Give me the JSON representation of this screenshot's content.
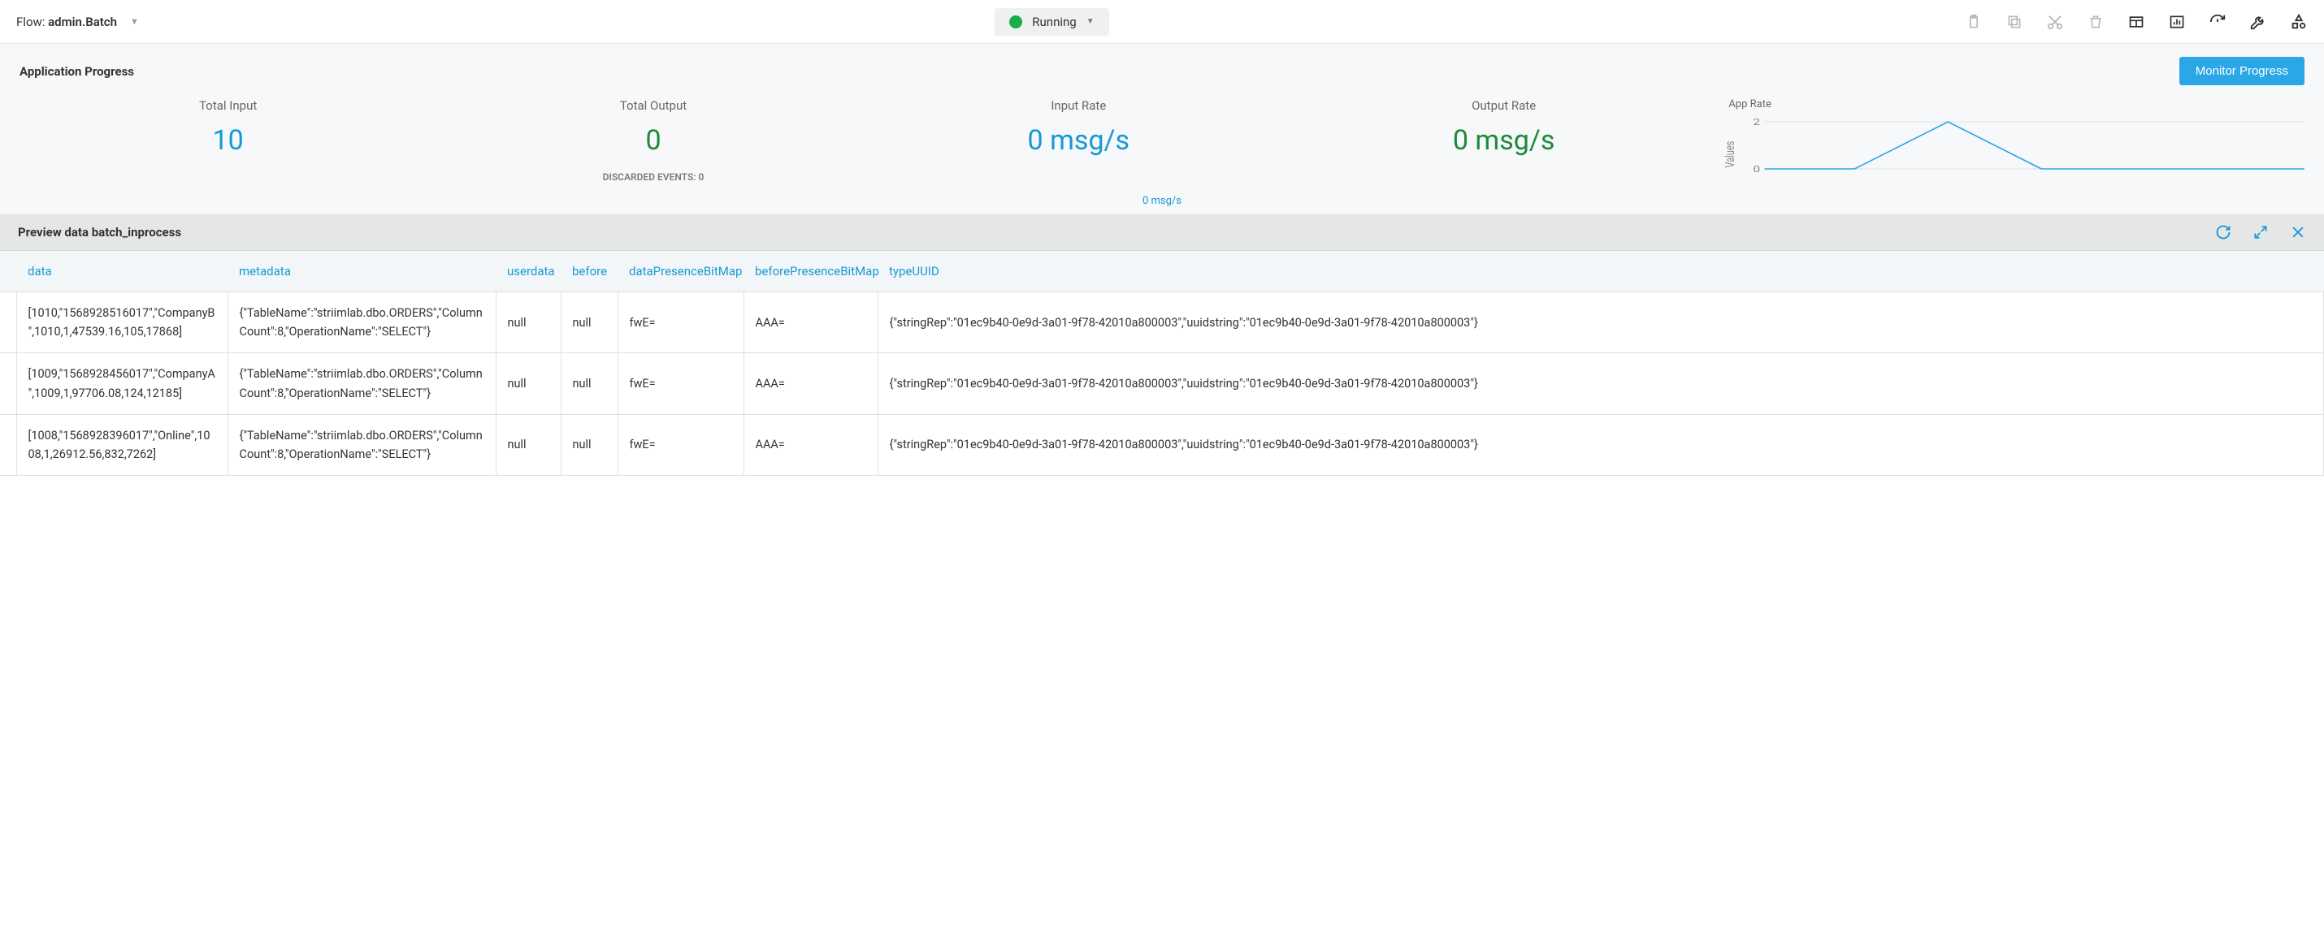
{
  "header": {
    "flow_prefix": "Flow: ",
    "flow_name": "admin.Batch",
    "status_text": "Running"
  },
  "progress": {
    "title": "Application Progress",
    "monitor_label": "Monitor Progress",
    "metrics": {
      "total_input_label": "Total Input",
      "total_input_value": "10",
      "total_output_label": "Total Output",
      "total_output_value": "0",
      "input_rate_label": "Input Rate",
      "input_rate_value": "0 msg/s",
      "output_rate_label": "Output Rate",
      "output_rate_value": "0 msg/s",
      "discarded_label": "DISCARDED EVENTS: 0"
    },
    "chart_title": "App Rate",
    "chart_ylabel": "Values",
    "rate_bubble": "0 msg/s"
  },
  "chart_data": {
    "type": "line",
    "title": "App Rate",
    "ylabel": "Values",
    "ylim": [
      0,
      2
    ],
    "yticks": [
      0,
      2
    ],
    "x": [
      0,
      1,
      2,
      3,
      4,
      5,
      6
    ],
    "values": [
      0,
      0,
      2,
      0,
      0,
      0,
      0
    ]
  },
  "preview": {
    "title": "Preview data batch_inprocess",
    "columns": [
      "data",
      "metadata",
      "userdata",
      "before",
      "dataPresenceBitMap",
      "beforePresenceBitMap",
      "typeUUID"
    ],
    "rows": [
      {
        "data": "[1010,\"1568928516017\",\"CompanyB\",1010,1,47539.16,105,17868]",
        "metadata": "{\"TableName\":\"striimlab.dbo.ORDERS\",\"ColumnCount\":8,\"OperationName\":\"SELECT\"}",
        "userdata": "null",
        "before": "null",
        "dataPresenceBitMap": "fwE=",
        "beforePresenceBitMap": "AAA=",
        "typeUUID": "{\"stringRep\":\"01ec9b40-0e9d-3a01-9f78-42010a800003\",\"uuidstring\":\"01ec9b40-0e9d-3a01-9f78-42010a800003\"}"
      },
      {
        "data": "[1009,\"1568928456017\",\"CompanyA\",1009,1,97706.08,124,12185]",
        "metadata": "{\"TableName\":\"striimlab.dbo.ORDERS\",\"ColumnCount\":8,\"OperationName\":\"SELECT\"}",
        "userdata": "null",
        "before": "null",
        "dataPresenceBitMap": "fwE=",
        "beforePresenceBitMap": "AAA=",
        "typeUUID": "{\"stringRep\":\"01ec9b40-0e9d-3a01-9f78-42010a800003\",\"uuidstring\":\"01ec9b40-0e9d-3a01-9f78-42010a800003\"}"
      },
      {
        "data": "[1008,\"1568928396017\",\"Online\",1008,1,26912.56,832,7262]",
        "metadata": "{\"TableName\":\"striimlab.dbo.ORDERS\",\"ColumnCount\":8,\"OperationName\":\"SELECT\"}",
        "userdata": "null",
        "before": "null",
        "dataPresenceBitMap": "fwE=",
        "beforePresenceBitMap": "AAA=",
        "typeUUID": "{\"stringRep\":\"01ec9b40-0e9d-3a01-9f78-42010a800003\",\"uuidstring\":\"01ec9b40-0e9d-3a01-9f78-42010a800003\"}"
      }
    ]
  }
}
